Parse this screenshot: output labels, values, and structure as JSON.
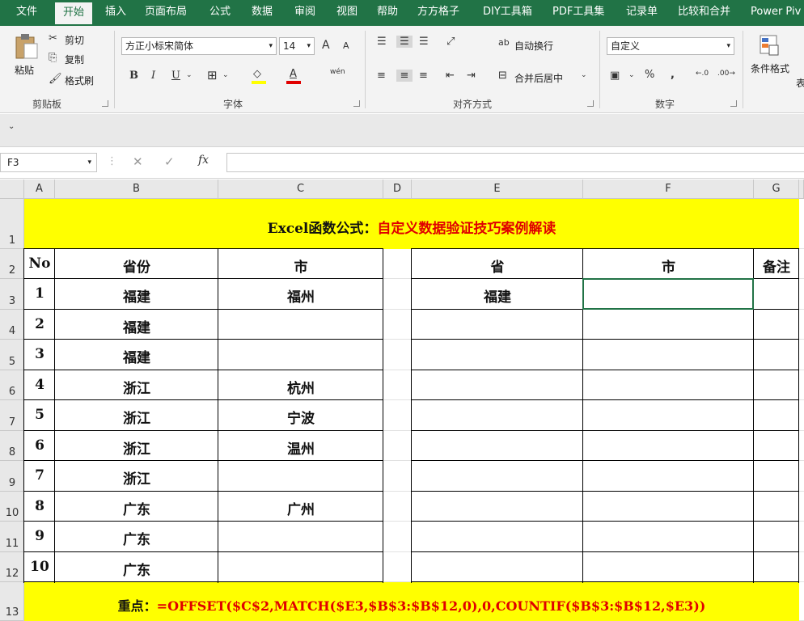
{
  "ribbon_tabs": [
    "文件",
    "开始",
    "插入",
    "页面布局",
    "公式",
    "数据",
    "审阅",
    "视图",
    "帮助",
    "方方格子",
    "DIY工具箱",
    "PDF工具集",
    "记录单",
    "比较和合并",
    "Power Piv"
  ],
  "clipboard": {
    "paste": "粘贴",
    "cut": "剪切",
    "copy": "复制",
    "format_painter": "格式刷",
    "group": "剪贴板"
  },
  "font": {
    "name": "方正小标宋简体",
    "size": "14",
    "group": "字体",
    "bold": "B",
    "italic": "I",
    "underline": "U",
    "grow": "A",
    "shrink": "A",
    "font_color": "A",
    "phonetic": "wén"
  },
  "alignment": {
    "wrap": "自动换行",
    "merge": "合并后居中",
    "group": "对齐方式"
  },
  "number": {
    "format": "自定义",
    "percent": "%",
    "comma": ",",
    "group": "数字"
  },
  "styles": {
    "conditional": "条件格式",
    "cut_label": "表"
  },
  "formula_bar": {
    "name_box": "F3",
    "fx": "fx",
    "value": ""
  },
  "columns": [
    "A",
    "B",
    "C",
    "D",
    "E",
    "F",
    "G"
  ],
  "rows": [
    "1",
    "2",
    "3",
    "4",
    "5",
    "6",
    "7",
    "8",
    "9",
    "10",
    "11",
    "12",
    "13"
  ],
  "sheet": {
    "title_black": "Excel函数公式：",
    "title_red": "自定义数据验证技巧案例解读",
    "left_headers": [
      "No",
      "省份",
      "市"
    ],
    "right_headers": [
      "省",
      "市",
      "备注"
    ],
    "left_rows": [
      [
        "1",
        "福建",
        "福州"
      ],
      [
        "2",
        "福建",
        ""
      ],
      [
        "3",
        "福建",
        ""
      ],
      [
        "4",
        "浙江",
        "杭州"
      ],
      [
        "5",
        "浙江",
        "宁波"
      ],
      [
        "6",
        "浙江",
        "温州"
      ],
      [
        "7",
        "浙江",
        ""
      ],
      [
        "8",
        "广东",
        "广州"
      ],
      [
        "9",
        "广东",
        ""
      ],
      [
        "10",
        "广东",
        ""
      ]
    ],
    "right_e3": "福建",
    "note_black": "重点：",
    "note_red": "=OFFSET($C$2,MATCH($E3,$B$3:$B$12,0),0,COUNTIF($B$3:$B$12,$E3))"
  },
  "colors": {
    "excel_green": "#217346",
    "highlight": "#ffff00",
    "red": "#e00000"
  }
}
